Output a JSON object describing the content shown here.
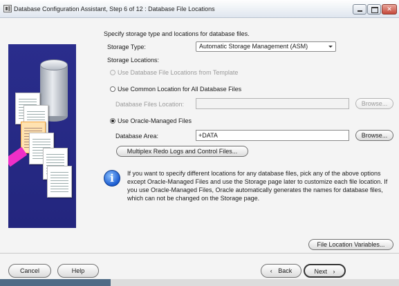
{
  "window": {
    "title": "Database Configuration Assistant, Step 6 of 12 : Database File Locations"
  },
  "content": {
    "intro": "Specify storage type and locations for database files.",
    "storage_type_label": "Storage Type:",
    "storage_type_value": "Automatic Storage Management (ASM)",
    "storage_locations_label": "Storage Locations:",
    "option_template": "Use Database File Locations from Template",
    "option_common": "Use Common Location for All Database Files",
    "db_files_location_label": "Database Files Location:",
    "db_files_location_value": "",
    "browse_label": "Browse...",
    "option_omf": "Use Oracle-Managed Files",
    "database_area_label": "Database Area:",
    "database_area_value": "+DATA",
    "multiplex_label": "Multiplex Redo Logs and Control Files...",
    "info_text": "If you want to specify different locations for any database files, pick any of the above options except Oracle-Managed Files and use the Storage page later to customize each file location. If you use Oracle-Managed Files, Oracle automatically generates the names for database files, which can not be changed on the Storage page.",
    "file_location_variables_label": "File Location Variables...",
    "selected_option": "omf"
  },
  "footer": {
    "cancel_label": "Cancel",
    "help_label": "Help",
    "back_label": "Back",
    "next_label": "Next"
  },
  "icons": {
    "window": "dbca-app-icon",
    "info": "info-icon",
    "back": "chevron-left-icon",
    "next": "chevron-right-icon",
    "dropdown": "chevron-down-icon"
  },
  "colors": {
    "illustration_bg": "#2a2d8c",
    "arrow": "#ef2fc7",
    "highlight_paper": "#ffe2b0"
  }
}
